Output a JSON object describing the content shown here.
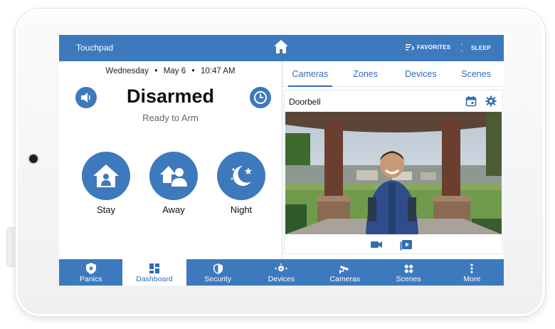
{
  "topbar": {
    "title": "Touchpad",
    "home_icon": "home-icon",
    "favorites_label": "FAVORITES",
    "sleep_label": "SLEEP"
  },
  "status_panel": {
    "day": "Wednesday",
    "date": "May 6",
    "time": "10:47 AM",
    "status": "Disarmed",
    "substatus": "Ready to Arm",
    "arm_buttons": [
      {
        "label": "Stay",
        "icon": "house-person-icon"
      },
      {
        "label": "Away",
        "icon": "house-people-icon"
      },
      {
        "label": "Night",
        "icon": "moon-stars-icon"
      }
    ]
  },
  "right_panel": {
    "tabs": [
      {
        "label": "Cameras",
        "active": true
      },
      {
        "label": "Zones",
        "active": false
      },
      {
        "label": "Devices",
        "active": false
      },
      {
        "label": "Scenes",
        "active": false
      }
    ],
    "camera": {
      "name": "Doorbell"
    }
  },
  "bottom_nav": [
    {
      "label": "Panics",
      "icon": "shield-star-icon",
      "active": false
    },
    {
      "label": "Dashboard",
      "icon": "dashboard-grid-icon",
      "active": true
    },
    {
      "label": "Security",
      "icon": "shield-icon",
      "active": false
    },
    {
      "label": "Devices",
      "icon": "devices-icon",
      "active": false
    },
    {
      "label": "Cameras",
      "icon": "cctv-icon",
      "active": false
    },
    {
      "label": "Scenes",
      "icon": "scenes-icon",
      "active": false
    },
    {
      "label": "More",
      "icon": "more-vertical-icon",
      "active": false
    }
  ],
  "colors": {
    "brand_blue": "#3d79bd",
    "tab_blue": "#2f6eb5"
  }
}
